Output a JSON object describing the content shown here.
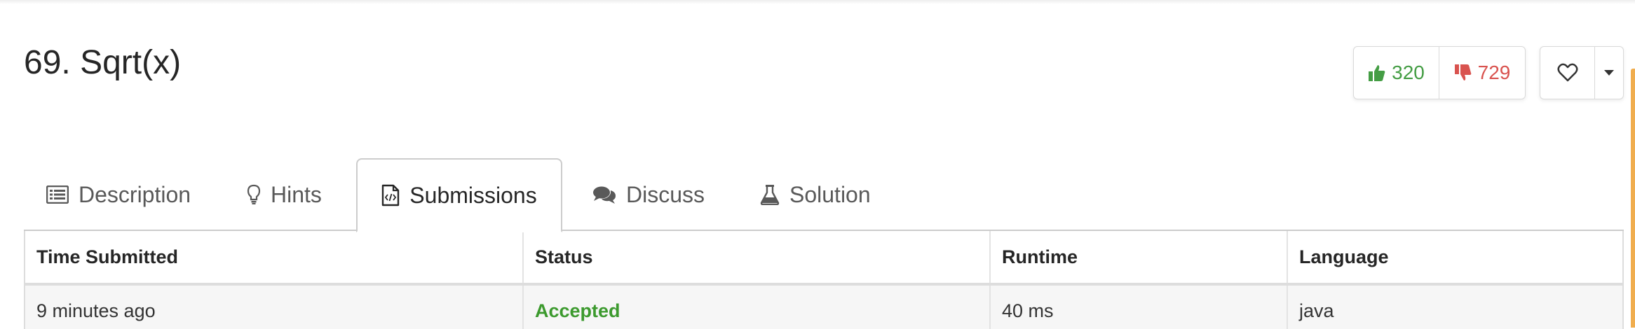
{
  "problem": {
    "title": "69. Sqrt(x)"
  },
  "votes": {
    "upvotes": "320",
    "downvotes": "729"
  },
  "tabs": [
    {
      "label": "Description",
      "icon": "list-icon"
    },
    {
      "label": "Hints",
      "icon": "lightbulb-icon"
    },
    {
      "label": "Submissions",
      "icon": "code-file-icon",
      "active": true
    },
    {
      "label": "Discuss",
      "icon": "comments-icon"
    },
    {
      "label": "Solution",
      "icon": "flask-icon"
    }
  ],
  "submissions": {
    "headers": [
      "Time Submitted",
      "Status",
      "Runtime",
      "Language"
    ],
    "rows": [
      {
        "time": "9 minutes ago",
        "status": "Accepted",
        "runtime": "40 ms",
        "language": "java"
      }
    ]
  },
  "colors": {
    "upvote": "#449d44",
    "downvote": "#d9534f",
    "accepted": "#3c9a2e",
    "accent_edge": "#f0ad4e"
  }
}
